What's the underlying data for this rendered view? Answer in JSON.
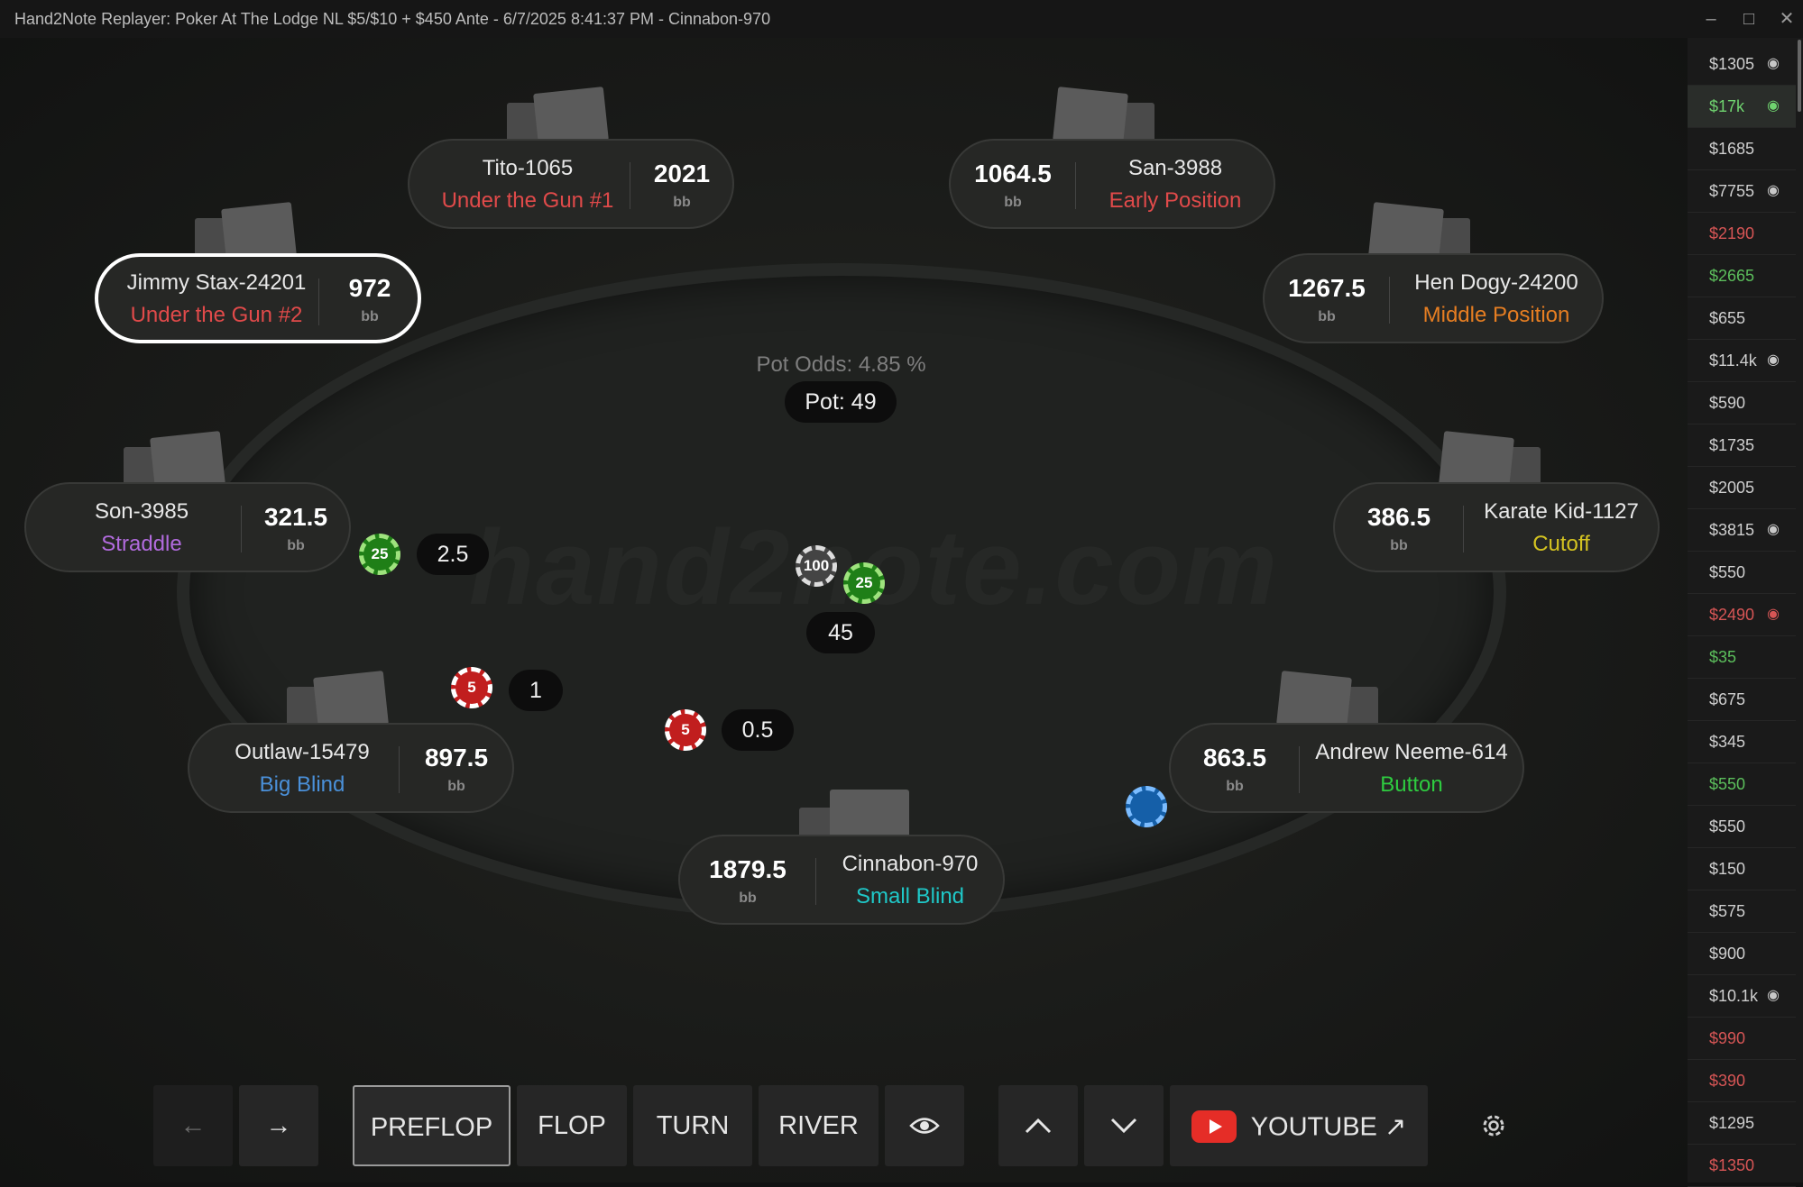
{
  "window": {
    "title": "Hand2Note Replayer: Poker At The Lodge NL $5/$10 + $450 Ante - 6/7/2025 8:41:37 PM - Cinnabon-970"
  },
  "watermark": "hand2note.com",
  "pot": {
    "odds": "Pot Odds: 4.85 %",
    "label": "Pot: 49",
    "center_bet": "45",
    "chip_values": [
      "100",
      "25"
    ]
  },
  "seats": [
    {
      "name": "Tito-1065",
      "position": "Under the Gun #1",
      "stack": "2021",
      "unit": "bb",
      "pos_color": "#e04a4a"
    },
    {
      "name": "San-3988",
      "position": "Early Position",
      "stack": "1064.5",
      "unit": "bb",
      "pos_color": "#e04a4a"
    },
    {
      "name": "Jimmy Stax-24201",
      "position": "Under the Gun #2",
      "stack": "972",
      "unit": "bb",
      "pos_color": "#e04a4a"
    },
    {
      "name": "Hen Dogy-24200",
      "position": "Middle Position",
      "stack": "1267.5",
      "unit": "bb",
      "pos_color": "#e67e22"
    },
    {
      "name": "Son-3985",
      "position": "Straddle",
      "stack": "321.5",
      "unit": "bb",
      "pos_color": "#b26bde"
    },
    {
      "name": "Karate Kid-1127",
      "position": "Cutoff",
      "stack": "386.5",
      "unit": "bb",
      "pos_color": "#d4c321"
    },
    {
      "name": "Outlaw-15479",
      "position": "Big Blind",
      "stack": "897.5",
      "unit": "bb",
      "pos_color": "#4a90d9"
    },
    {
      "name": "Andrew Neeme-614",
      "position": "Button",
      "stack": "863.5",
      "unit": "bb",
      "pos_color": "#2ecc40"
    },
    {
      "name": "Cinnabon-970",
      "position": "Small Blind",
      "stack": "1879.5",
      "unit": "bb",
      "pos_color": "#1fc8c8"
    }
  ],
  "bets": {
    "straddle": "2.5",
    "straddle_chip": "25",
    "bb": "1",
    "bb_chip": "5",
    "sb": "0.5",
    "sb_chip": "5"
  },
  "controls": {
    "prev": "←",
    "next": "→",
    "preflop": "PREFLOP",
    "flop": "FLOP",
    "turn": "TURN",
    "river": "RIVER",
    "up": "^",
    "down": "v",
    "youtube": "YOUTUBE ↗"
  },
  "sidebar": {
    "items": [
      {
        "amount": "$1305",
        "color": "#cfcfcf",
        "eye": true
      },
      {
        "amount": "$17k",
        "color": "#6fd36f",
        "eye": true,
        "selected": true
      },
      {
        "amount": "$1685",
        "color": "#cfcfcf",
        "eye": false
      },
      {
        "amount": "$7755",
        "color": "#cfcfcf",
        "eye": true
      },
      {
        "amount": "$2190",
        "color": "#d65555",
        "eye": false
      },
      {
        "amount": "$2665",
        "color": "#5cbf5c",
        "eye": false
      },
      {
        "amount": "$655",
        "color": "#cfcfcf",
        "eye": false
      },
      {
        "amount": "$11.4k",
        "color": "#cfcfcf",
        "eye": true
      },
      {
        "amount": "$590",
        "color": "#cfcfcf",
        "eye": false
      },
      {
        "amount": "$1735",
        "color": "#cfcfcf",
        "eye": false
      },
      {
        "amount": "$2005",
        "color": "#cfcfcf",
        "eye": false
      },
      {
        "amount": "$3815",
        "color": "#cfcfcf",
        "eye": true
      },
      {
        "amount": "$550",
        "color": "#cfcfcf",
        "eye": false
      },
      {
        "amount": "$2490",
        "color": "#d65555",
        "eye": true
      },
      {
        "amount": "$35",
        "color": "#5cbf5c",
        "eye": false
      },
      {
        "amount": "$675",
        "color": "#cfcfcf",
        "eye": false
      },
      {
        "amount": "$345",
        "color": "#cfcfcf",
        "eye": false
      },
      {
        "amount": "$550",
        "color": "#5cbf5c",
        "eye": false
      },
      {
        "amount": "$550",
        "color": "#cfcfcf",
        "eye": false
      },
      {
        "amount": "$150",
        "color": "#cfcfcf",
        "eye": false
      },
      {
        "amount": "$575",
        "color": "#cfcfcf",
        "eye": false
      },
      {
        "amount": "$900",
        "color": "#cfcfcf",
        "eye": false
      },
      {
        "amount": "$10.1k",
        "color": "#cfcfcf",
        "eye": true
      },
      {
        "amount": "$990",
        "color": "#d65555",
        "eye": false
      },
      {
        "amount": "$390",
        "color": "#d65555",
        "eye": false
      },
      {
        "amount": "$1295",
        "color": "#cfcfcf",
        "eye": false
      },
      {
        "amount": "$1350",
        "color": "#d65555",
        "eye": false
      }
    ]
  }
}
